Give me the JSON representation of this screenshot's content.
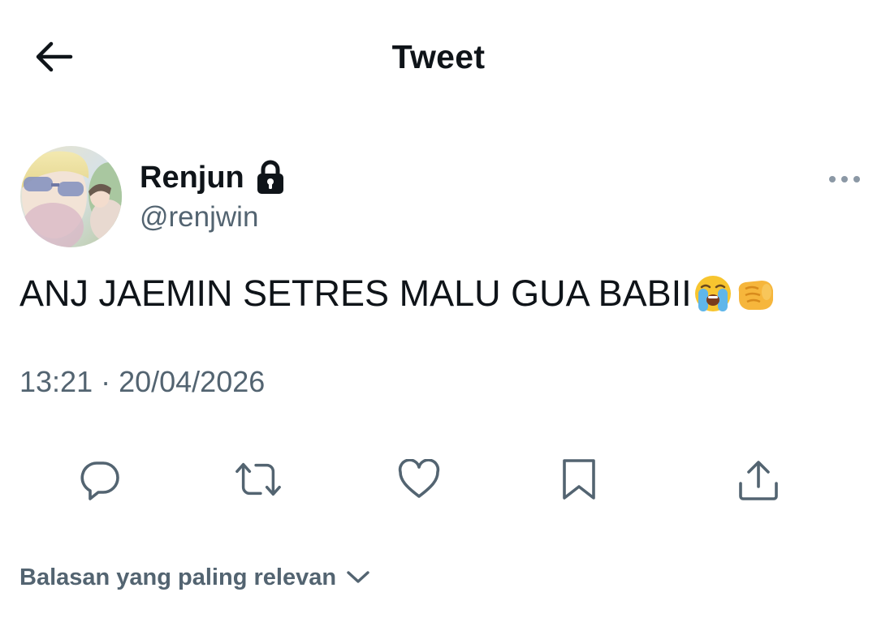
{
  "header": {
    "title": "Tweet",
    "back_icon": "arrow-left-icon"
  },
  "author": {
    "display_name": "Renjun",
    "handle": "@renjwin",
    "protected_icon": "lock-icon",
    "avatar_icon": "profile-photo"
  },
  "tweet": {
    "text": "ANJ JAEMIN SETRES MALU GUA BABII",
    "emojis": [
      "loudly-crying-face",
      "oncoming-fist"
    ],
    "time": "13:21",
    "separator": "·",
    "date": "20/04/2026"
  },
  "actions": [
    {
      "name": "reply",
      "icon": "reply-icon"
    },
    {
      "name": "retweet",
      "icon": "retweet-icon"
    },
    {
      "name": "like",
      "icon": "heart-icon"
    },
    {
      "name": "bookmark",
      "icon": "bookmark-icon"
    },
    {
      "name": "share",
      "icon": "share-icon"
    }
  ],
  "replies_sort": {
    "label": "Balasan yang paling relevan",
    "icon": "chevron-down-icon"
  },
  "colors": {
    "text_primary": "#0f1419",
    "text_secondary": "#536471",
    "background": "#ffffff"
  }
}
